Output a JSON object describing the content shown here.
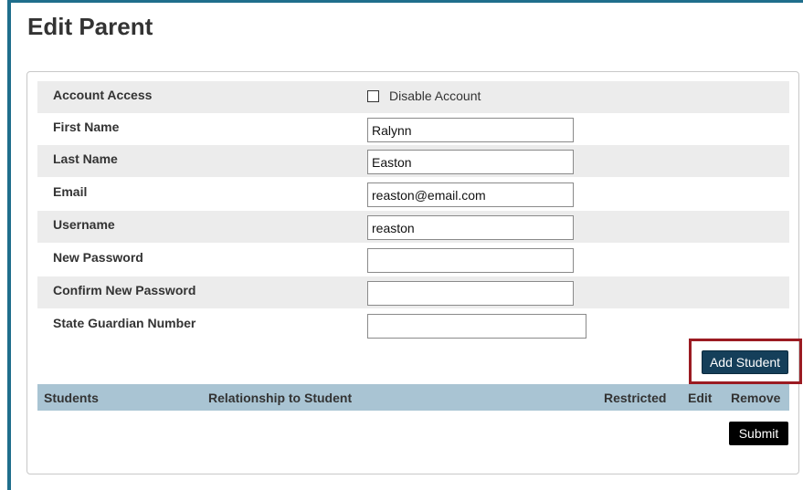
{
  "page": {
    "title": "Edit Parent"
  },
  "form": {
    "account_access": {
      "label": "Account Access",
      "checkbox_label": "Disable Account",
      "checked": false
    },
    "first_name": {
      "label": "First Name",
      "value": "Ralynn"
    },
    "last_name": {
      "label": "Last Name",
      "value": "Easton"
    },
    "email": {
      "label": "Email",
      "value": "reaston@email.com"
    },
    "username": {
      "label": "Username",
      "value": "reaston"
    },
    "new_password": {
      "label": "New Password",
      "value": ""
    },
    "confirm_password": {
      "label": "Confirm New Password",
      "value": ""
    },
    "state_guardian_number": {
      "label": "State Guardian Number",
      "value": ""
    }
  },
  "buttons": {
    "add_student": "Add Student",
    "submit": "Submit"
  },
  "students_table": {
    "columns": [
      "Students",
      "Relationship to Student",
      "Restricted",
      "Edit",
      "Remove"
    ]
  },
  "colors": {
    "accent": "#1f6e8c",
    "highlight": "#9b1b22",
    "table_header": "#a9c4d3",
    "button": "#153f5a"
  }
}
